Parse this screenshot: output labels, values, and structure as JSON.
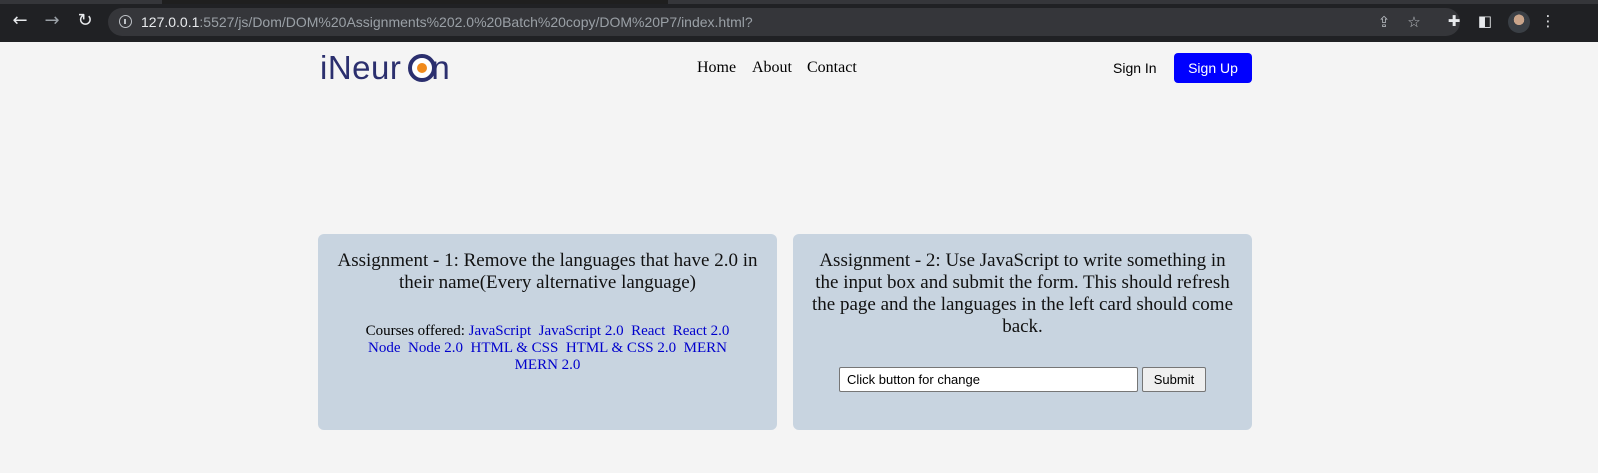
{
  "browser": {
    "url_host": "127.0.0.1",
    "url_path": ":5527/js/Dom/DOM%20Assignments%202.0%20Batch%20copy/DOM%20P7/index.html?"
  },
  "site": {
    "logo_text": "iNeuron",
    "nav": [
      "Home",
      "About",
      "Contact"
    ],
    "sign_in": "Sign In",
    "sign_up": "Sign Up"
  },
  "assignment1": {
    "title": "Assignment - 1: Remove the languages that have 2.0 in their name(Every alternative language)",
    "courses_label": "Courses offered:",
    "languages": [
      "JavaScript",
      "JavaScript 2.0",
      "React",
      "React 2.0",
      "Node",
      "Node 2.0",
      "HTML & CSS",
      "HTML & CSS 2.0",
      "MERN",
      "MERN 2.0"
    ]
  },
  "assignment2": {
    "title": "Assignment - 2: Use JavaScript to write something in the input box and submit the form. This should refresh the page and the languages in the left card should come back.",
    "input_value": "Click button for change",
    "submit_label": "Submit"
  },
  "colors": {
    "chrome_bg": "#202124",
    "page_bg": "#f4f4f4",
    "card_bg": "#c8d4e0",
    "signup_bg": "#0000ff",
    "link": "#0000cc",
    "logo_dark": "#2b2f6e",
    "logo_accent": "#f08a1c"
  },
  "icons": [
    "back-arrow-icon",
    "forward-arrow-icon",
    "reload-icon",
    "info-icon",
    "share-icon",
    "star-icon",
    "extensions-icon",
    "side-panel-icon",
    "profile-avatar",
    "kebab-menu-icon"
  ]
}
